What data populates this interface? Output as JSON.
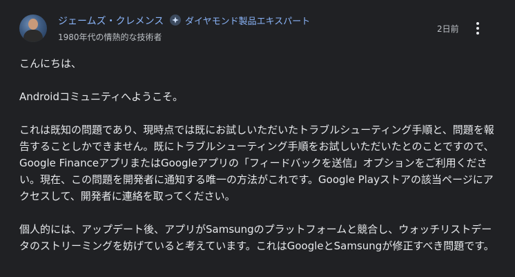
{
  "author": {
    "name": "ジェームズ・クレメンス",
    "badge": "ダイヤモンド製品エキスパート",
    "subtitle": "1980年代の情熱的な技術者",
    "avatar_icon": "user-avatar"
  },
  "post": {
    "timestamp": "2日前",
    "more_icon": "more-vert-icon",
    "paragraphs": [
      "こんにちは、",
      "Androidコミュニティへようこそ。",
      "これは既知の問題であり、現時点では既にお試しいただいたトラブルシューティング手順と、問題を報告することしかできません。既にトラブルシューティング手順をお試しいただいたとのことですので、Google FinanceアプリまたはGoogleアプリの「フィードバックを送信」オプションをご利用ください。現在、この問題を開発者に通知する唯一の方法がこれです。Google Playストアの該当ページにアクセスして、開発者に連絡を取ってください。",
      "個人的には、アップデート後、アプリがSamsungのプラットフォームと競合し、ウォッチリストデータのストリーミングを妨げていると考えています。これはGoogleとSamsungが修正すべき問題です。"
    ]
  },
  "colors": {
    "background": "#202124",
    "text": "#e8eaed",
    "secondary_text": "#bdc1c6",
    "link": "#8ab4f8"
  }
}
